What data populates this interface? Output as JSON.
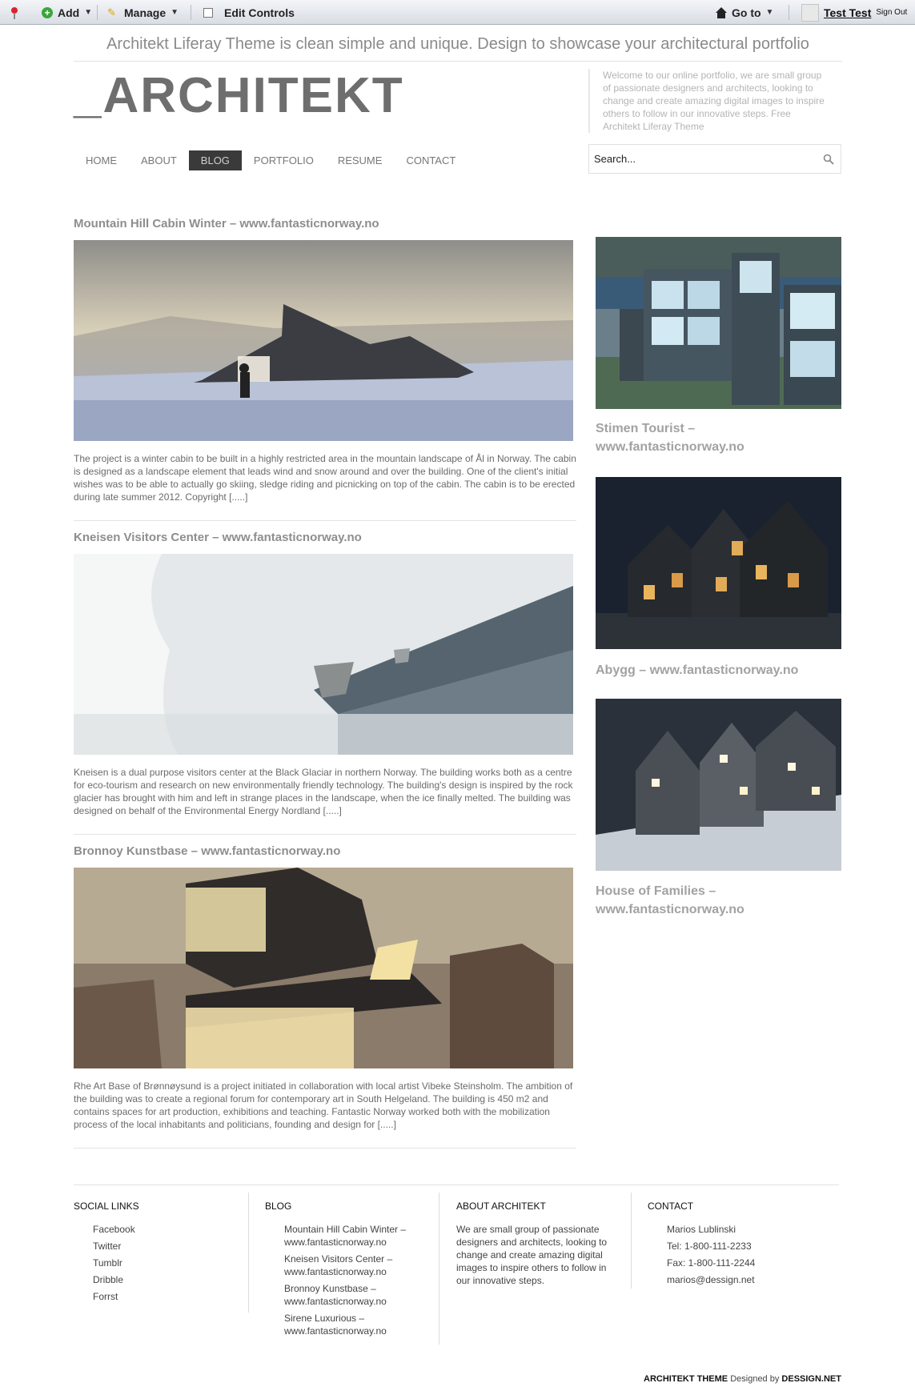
{
  "dockbar": {
    "add_label": "Add",
    "manage_label": "Manage",
    "edit_controls_label": "Edit Controls",
    "goto_label": "Go to",
    "user_name": "Test Test",
    "signout_label": "Sign Out"
  },
  "header": {
    "tagline": "Architekt Liferay Theme is clean simple and unique. Design to showcase your architectural portfolio",
    "logo": "_ARCHITEKT",
    "welcome": "Welcome to our online portfolio, we are small group of passionate designers and architects, looking to change and create amazing digital images to inspire others to follow in our innovative steps. Free Architekt Liferay Theme"
  },
  "nav": {
    "items": [
      "HOME",
      "ABOUT",
      "BLOG",
      "PORTFOLIO",
      "RESUME",
      "CONTACT"
    ],
    "active": "BLOG"
  },
  "search": {
    "placeholder": "Search..."
  },
  "posts": [
    {
      "title": "Mountain Hill Cabin Winter – www.fantasticnorway.no",
      "excerpt": "The project is a winter cabin to be built in a highly restricted area in the mountain landscape of Ål in Norway. The cabin is designed as a landscape element that leads wind and snow around and over the building. One of the client's initial wishes was to be able to actually go skiing, sledge riding and picnicking on top of the cabin. The cabin is to be erected during late summer 2012. Copyright [.....]"
    },
    {
      "title": "Kneisen Visitors Center – www.fantasticnorway.no",
      "excerpt": "Kneisen is a dual purpose visitors center at the Black Glaciar in northern Norway. The building works both as a centre for eco-tourism and research on new environmentally friendly technology. The building's design is inspired by the rock glacier has brought with him and left in strange places in the landscape, when the ice finally melted. The building was designed on behalf of the Environmental Energy Nordland [.....]"
    },
    {
      "title": "Bronnoy Kunstbase – www.fantasticnorway.no",
      "excerpt": "Rhe Art Base of Brønnøysund is a project initiated in collaboration with local artist Vibeke Steinsholm. The ambition of the building was to create a regional forum for contemporary art in South Helgeland. The building is 450 m2 and contains spaces for art production, exhibitions and teaching. Fantastic Norway worked both with the mobilization process of the local inhabitants and politicians, founding and design for [.....]"
    }
  ],
  "sidebar": [
    {
      "title": "Stimen Tourist – www.fantasticnorway.no"
    },
    {
      "title": "Abygg – www.fantasticnorway.no"
    },
    {
      "title": "House of Families – www.fantasticnorway.no"
    }
  ],
  "footer": {
    "social": {
      "heading": "SOCIAL LINKS",
      "links": [
        "Facebook",
        "Twitter",
        "Tumblr",
        "Dribble",
        "Forrst"
      ]
    },
    "blog": {
      "heading": "BLOG",
      "links": [
        "Mountain Hill Cabin Winter – www.fantasticnorway.no",
        "Kneisen Visitors Center – www.fantasticnorway.no",
        "Bronnoy Kunstbase – www.fantasticnorway.no",
        "Sirene Luxurious – www.fantasticnorway.no"
      ]
    },
    "about": {
      "heading": "ABOUT ARCHITEKT",
      "text": "We are small group of passionate designers and architects, looking to change and create amazing digital images to inspire others to follow in our innovative steps."
    },
    "contact": {
      "heading": "CONTACT",
      "lines": [
        "Marios Lublinski",
        "Tel: 1-800-111-2233",
        "Fax: 1-800-111-2244",
        "marios@dessign.net"
      ]
    },
    "credit_theme": "ARCHITEKT THEME",
    "credit_by": "Designed by",
    "credit_site": "DESSIGN.NET"
  },
  "colors": {
    "active_nav_bg": "#3a3a3a",
    "text_gray": "#8e8e8e",
    "logo": "#6e6e6e"
  }
}
